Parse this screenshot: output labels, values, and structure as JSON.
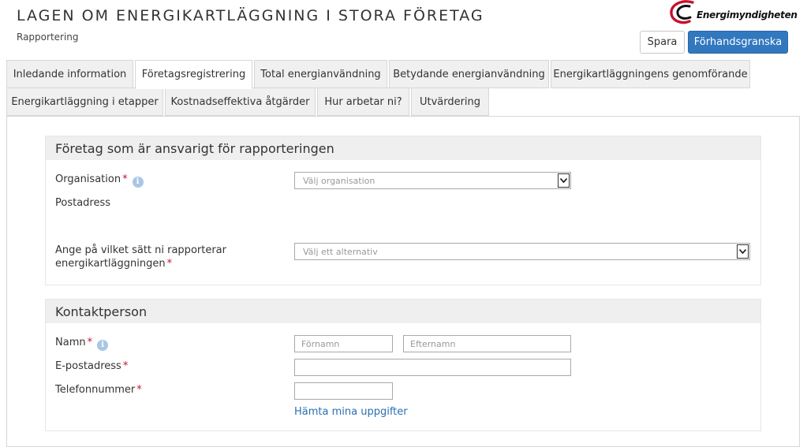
{
  "header": {
    "title": "LAGEN OM ENERGIKARTLÄGGNING I STORA FÖRETAG",
    "subtitle": "Rapportering",
    "logo_text": "Energimyndigheten",
    "save_label": "Spara",
    "preview_label": "Förhandsgranska"
  },
  "tabs": [
    {
      "label": "Inledande information"
    },
    {
      "label": "Företagsregistrering",
      "active": true
    },
    {
      "label": "Total energianvändning"
    },
    {
      "label": "Betydande energianvändning"
    },
    {
      "label": "Energikartläggningens genomförande"
    },
    {
      "label": "Energikartläggning i etapper"
    },
    {
      "label": "Kostnadseffektiva åtgärder"
    },
    {
      "label": "Hur arbetar ni?"
    },
    {
      "label": "Utvärdering"
    }
  ],
  "company_section": {
    "title": "Företag som är ansvarigt för rapporteringen",
    "organisation_label": "Organisation",
    "organisation_placeholder": "Välj organisation",
    "postal_address_label": "Postadress",
    "report_method_label_line1": "Ange på vilket sätt ni rapporterar",
    "report_method_label_line2": "energikartläggningen",
    "report_method_placeholder": "Välj ett alternativ"
  },
  "contact_section": {
    "title": "Kontaktperson",
    "name_label": "Namn",
    "first_name_placeholder": "Förnamn",
    "last_name_placeholder": "Efternamn",
    "email_label": "E-postadress",
    "phone_label": "Telefonnummer",
    "fetch_link": "Hämta mina uppgifter"
  },
  "required_marker": "*",
  "info_icon_glyph": "i",
  "colors": {
    "primary_button": "#3278bf",
    "required": "#c8102e",
    "link": "#2a6fb0",
    "logo_red": "#c8102e"
  }
}
